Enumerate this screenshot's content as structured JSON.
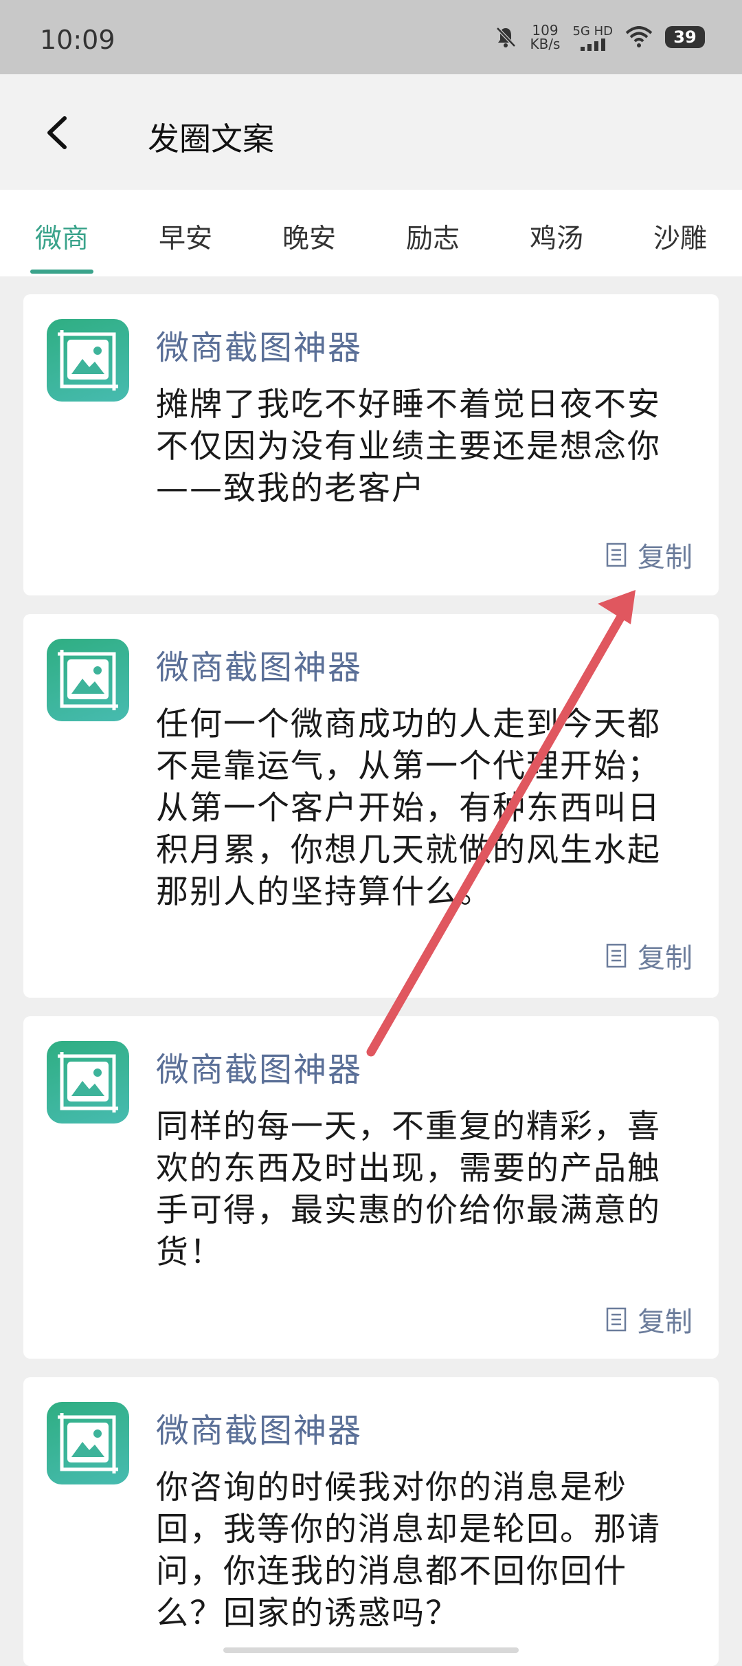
{
  "status_bar": {
    "time": "10:09",
    "net_speed_value": "109",
    "net_speed_unit": "KB/s",
    "signal_label": "5G HD",
    "battery": "39"
  },
  "header": {
    "title": "发圈文案"
  },
  "tabs": [
    {
      "label": "微商",
      "active": true
    },
    {
      "label": "早安"
    },
    {
      "label": "晚安"
    },
    {
      "label": "励志"
    },
    {
      "label": "鸡汤"
    },
    {
      "label": "沙雕"
    }
  ],
  "cards": [
    {
      "title": "微商截图神器",
      "lines": [
        "摊牌了我吃不好睡不着觉日夜不安",
        "不仅因为没有业绩主要还是想念你",
        "——致我的老客户"
      ],
      "copy_label": "复制"
    },
    {
      "title": "微商截图神器",
      "lines": [
        "任何一个微商成功的人走到今天都",
        "不是靠运气，从第一个代理开始；",
        "从第一个客户开始，有种东西叫日",
        "积月累，你想几天就做的风生水起",
        "那别人的坚持算什么。"
      ],
      "copy_label": "复制"
    },
    {
      "title": "微商截图神器",
      "lines": [
        "同样的每一天，不重复的精彩，喜",
        "欢的东西及时出现，需要的产品触",
        "手可得，最实惠的价给你最满意的",
        "货！"
      ],
      "copy_label": "复制"
    },
    {
      "title": "微商截图神器",
      "lines": [
        "你咨询的时候我对你的消息是秒",
        "回，我等你的消息却是轮回。那请",
        "问，你连我的消息都不回你回什",
        "么？回家的诱惑吗？"
      ],
      "copy_label": "复制"
    }
  ],
  "colors": {
    "accent": "#3aa38b",
    "card_title": "#5a6f97",
    "arrow": "#e0575f"
  }
}
